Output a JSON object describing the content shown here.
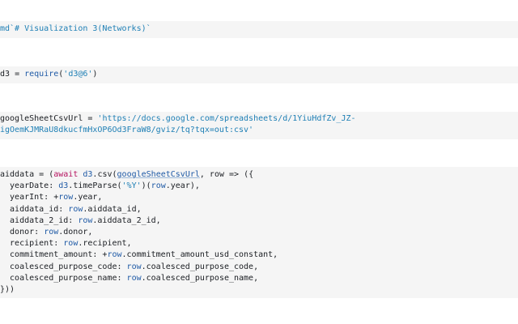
{
  "cells": {
    "md_cell": {
      "text": "md`# Visualization 3(Networks)`"
    },
    "require_cell": {
      "var": "d3",
      "op": " = ",
      "fn": "require",
      "open": "(",
      "arg": "'d3@6'",
      "close": ")"
    },
    "url_cell": {
      "var": "googleSheetCsvUrl",
      "op": " = ",
      "value_line1": "'https://docs.google.com/spreadsheets/d/1YiuHdfZv_JZ-",
      "value_line2": "igOemKJMRaU8dkucfmHxOP6Od3FraW8/gviz/tq?tqx=out:csv'"
    },
    "aiddata_cell": {
      "line1": {
        "a": "aiddata = (",
        "kw": "await",
        "b": " ",
        "d3": "d3",
        "c": ".csv(",
        "ref": "googleSheetCsvUrl",
        "d": ", row => ({"
      },
      "line2": {
        "a": "  yearDate: ",
        "d3": "d3",
        "b": ".timeParse(",
        "str": "'%Y'",
        "c": ")(",
        "row": "row",
        "d": ".year),"
      },
      "line3": {
        "a": "  yearInt: +",
        "row": "row",
        "b": ".year,"
      },
      "line4": {
        "a": "  aiddata_id: ",
        "row": "row",
        "b": ".aiddata_id,"
      },
      "line5": {
        "a": "  aiddata_2_id: ",
        "row": "row",
        "b": ".aiddata_2_id,"
      },
      "line6": {
        "a": "  donor: ",
        "row": "row",
        "b": ".donor,"
      },
      "line7": {
        "a": "  recipient: ",
        "row": "row",
        "b": ".recipient,"
      },
      "line8": {
        "a": "  commitment_amount: +",
        "row": "row",
        "b": ".commitment_amount_usd_constant,"
      },
      "line9": {
        "a": "  coalesced_purpose_code: ",
        "row": "row",
        "b": ".coalesced_purpose_code,"
      },
      "line10": {
        "a": "  coalesced_purpose_name: ",
        "row": "row",
        "b": ".coalesced_purpose_name,"
      },
      "line11": {
        "a": "}))"
      }
    }
  },
  "colors": {
    "cell_background": "#f5f5f5",
    "string": "#1e7fb5",
    "keyword": "#b5125f",
    "variable": "#1f5aa6",
    "text": "#1b1e23"
  }
}
